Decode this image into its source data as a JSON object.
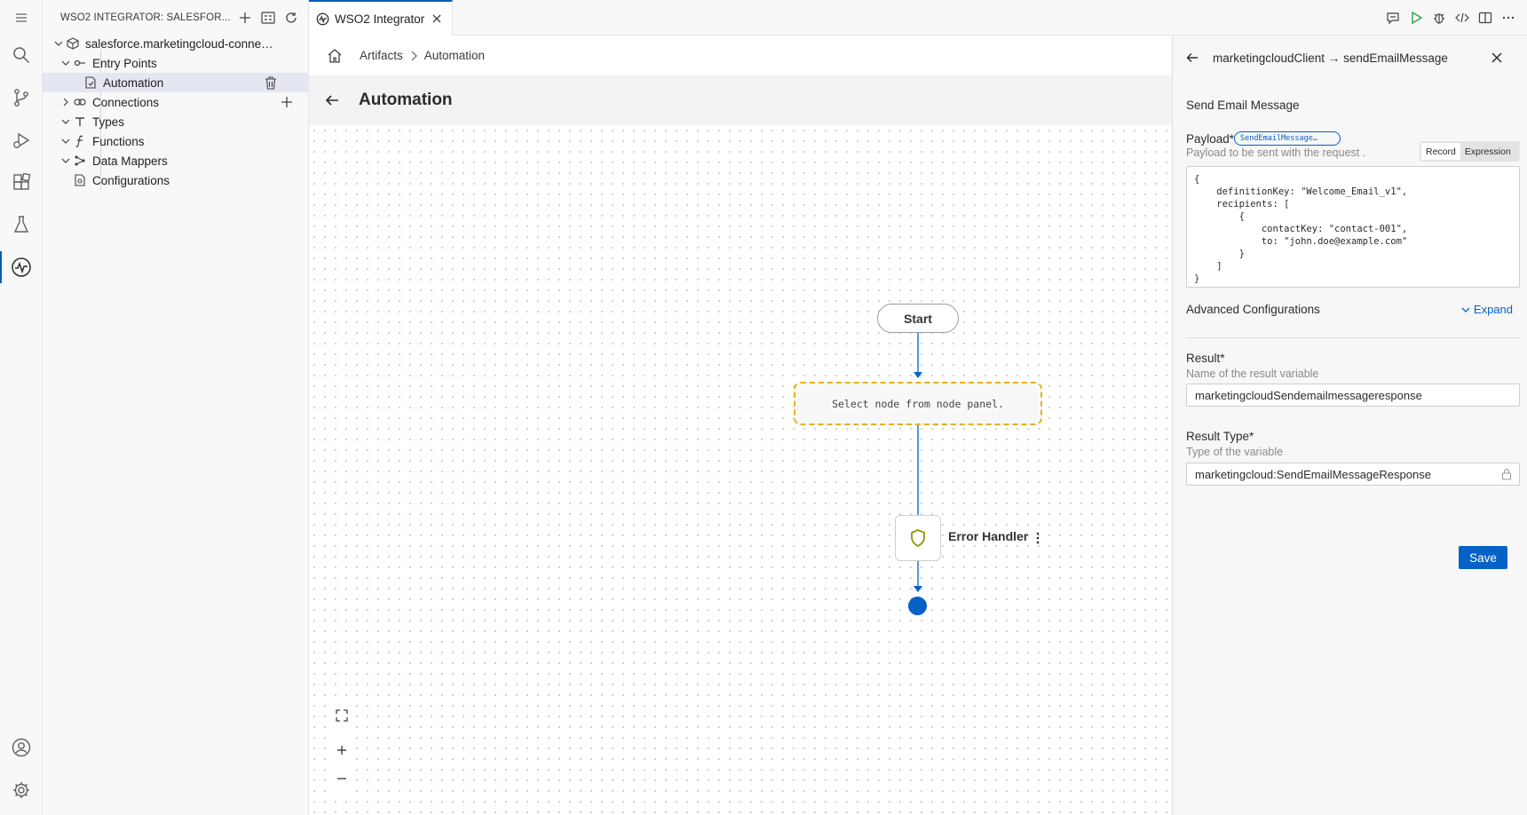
{
  "sidebar": {
    "title": "WSO2 INTEGRATOR: SALESFOR...",
    "project": "salesforce.marketingcloud-connecto...",
    "items": [
      {
        "label": "Entry Points"
      },
      {
        "label": "Automation"
      },
      {
        "label": "Connections"
      },
      {
        "label": "Types"
      },
      {
        "label": "Functions"
      },
      {
        "label": "Data Mappers"
      },
      {
        "label": "Configurations"
      }
    ]
  },
  "editor": {
    "tab_label": "WSO2 Integrator",
    "breadcrumb": [
      "Artifacts",
      "Automation"
    ],
    "page_title": "Automation"
  },
  "canvas": {
    "start_label": "Start",
    "placeholder_text": "Select node from node panel.",
    "error_handler_label": "Error Handler"
  },
  "panel": {
    "title": "marketingcloudClient → sendEmailMessage",
    "heading": "Send Email Message",
    "payload": {
      "label": "Payload*",
      "badge": "SendEmailMessage…",
      "help": "Payload to be sent with the request .",
      "modes": [
        "Record",
        "Expression"
      ],
      "active_mode": "Record",
      "value": "{\n    definitionKey: \"Welcome_Email_v1\",\n    recipients: [\n        {\n            contactKey: \"contact-001\",\n            to: \"john.doe@example.com\"\n        }\n    ]\n}"
    },
    "advanced": {
      "label": "Advanced Configurations",
      "expand": "Expand"
    },
    "result": {
      "label": "Result*",
      "help": "Name of the result variable",
      "value": "marketingcloudSendemailmessageresponse"
    },
    "result_type": {
      "label": "Result Type*",
      "help": "Type of the variable",
      "value": "marketingcloud:SendEmailMessageResponse"
    },
    "save": "Save"
  },
  "colors": {
    "accent": "#0561c6",
    "placeholder_border": "#e6b015",
    "error_shield": "#8a9a0a"
  }
}
